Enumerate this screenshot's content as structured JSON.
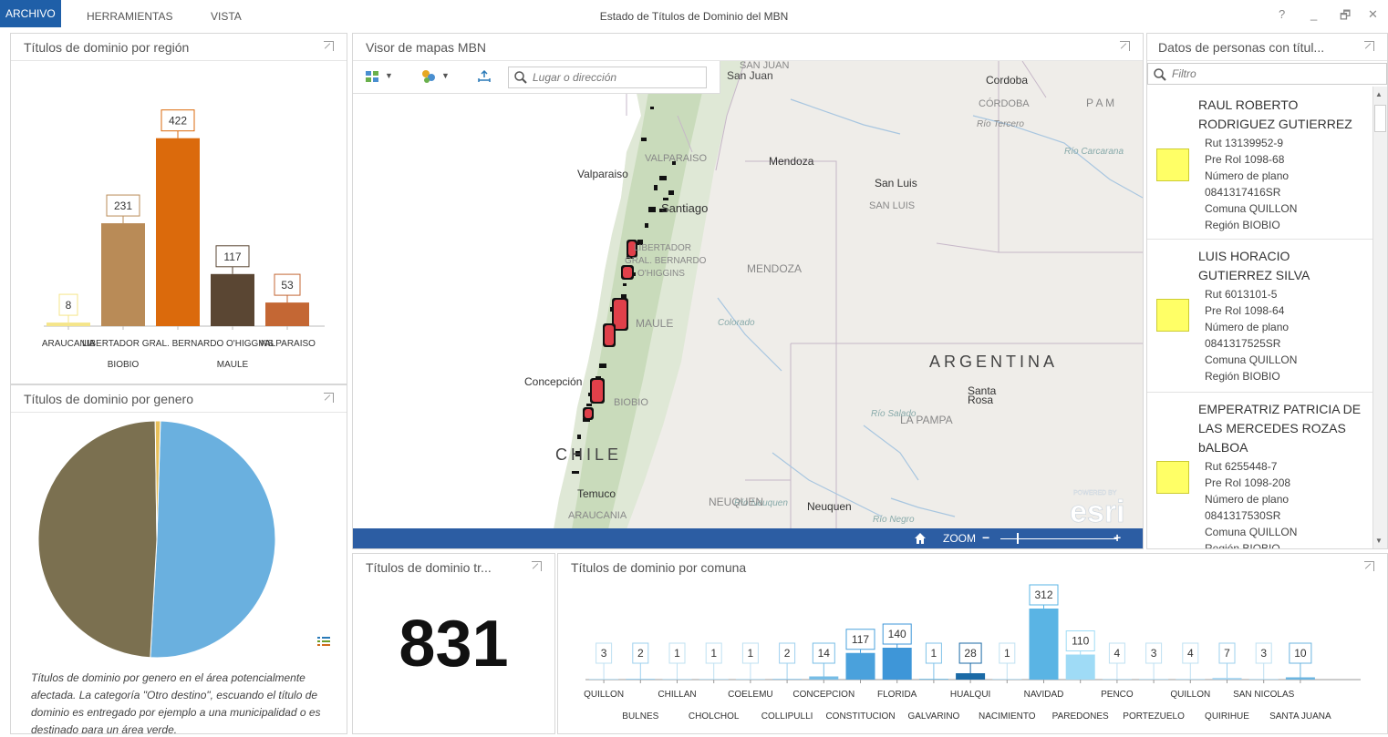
{
  "menu": {
    "archivo": "ARCHIVO",
    "herramientas": "HERRAMIENTAS",
    "vista": "VISTA"
  },
  "app_title": "Estado de Títulos de Dominio del MBN",
  "window": {
    "help": "?",
    "minimize": "_",
    "restore": "🗗",
    "close": "✕"
  },
  "panels": {
    "region_title": "Títulos de dominio por región",
    "gender_title": "Títulos de dominio por genero",
    "map_title": "Visor de mapas MBN",
    "persons_title": "Datos de personas con títul...",
    "total_title": "Títulos de dominio tr...",
    "comuna_title": "Títulos de dominio por comuna"
  },
  "region_chart": {
    "type": "bar",
    "categories": [
      "ARAUCANIA",
      "BIOBIO",
      "LIBERTADOR GRAL. BERNARDO O'HIGGINS",
      "MAULE",
      "VALPARAISO"
    ],
    "values": [
      8,
      231,
      422,
      117,
      53
    ],
    "colors": [
      "#f5e58a",
      "#b98b57",
      "#db6a0c",
      "#5a4633",
      "#c46734"
    ],
    "ylim": [
      0,
      450
    ]
  },
  "gender_chart": {
    "type": "pie",
    "values": [
      50.4,
      48.9,
      0.7
    ],
    "colors": [
      "#6ab0df",
      "#7b7050",
      "#e7bf5a"
    ],
    "legend_icon": "list-icon"
  },
  "gender_caption": "Títulos de dominio por genero en el área potencialmente afectada. La categoría \"Otro destino\", escuando el título de dominio es entregado por ejemplo a una municipalidad o es destinado para un área verde.",
  "map": {
    "search_placeholder": "Lugar o dirección",
    "labels": [
      "SAN JUAN",
      "San Juan",
      "Cordoba",
      "CÓRDOBA",
      "Río Tercero",
      "Río Carcarana",
      "Mendoza",
      "Valparaiso",
      "VALPARAISO",
      "San Luis",
      "SAN LUIS",
      "Santiago",
      "LIBERTADOR",
      "GRAL. BERNARDO",
      "O'HIGGINS",
      "MENDOZA",
      "MAULE",
      "Colorado",
      "ARGENTINA",
      "Concepción",
      "BIOBIO",
      "Santa",
      "Rosa",
      "LA PAMPA",
      "Río Salado",
      "CHILE",
      "Río Neuquen",
      "Temuco",
      "ARAUCANIA",
      "NEUQUEN",
      "Neuquen",
      "Río Negro",
      "P A M"
    ],
    "esri_small": "POWERED BY",
    "esri": "esri",
    "zoom_label": "ZOOM",
    "zoom_minus": "−",
    "zoom_plus": "+"
  },
  "filter_placeholder": "Filtro",
  "persons": [
    {
      "name": [
        "RAUL ROBERTO",
        "RODRIGUEZ GUTIERREZ"
      ],
      "details": [
        "Rut 13139952-9",
        "Pre Rol 1098-68",
        "Número de plano",
        "0841317416SR",
        "Comuna QUILLON",
        "Región BIOBIO"
      ]
    },
    {
      "name": [
        "LUIS HORACIO",
        "GUTIERREZ SILVA"
      ],
      "details": [
        "Rut 6013101-5",
        "Pre Rol 1098-64",
        "Número de plano",
        "0841317525SR",
        "Comuna QUILLON",
        "Región BIOBIO"
      ]
    },
    {
      "name": [
        "EMPERATRIZ PATRICIA DE",
        "LAS MERCEDES ROZAS",
        "bALBOA"
      ],
      "details": [
        "Rut 6255448-7",
        "Pre Rol 1098-208",
        "Número de plano",
        "0841317530SR",
        "Comuna QUILLON",
        "Región BIOBIO"
      ]
    }
  ],
  "total": "831",
  "comuna_chart": {
    "type": "bar",
    "categories": [
      "QUILLON",
      "BULNES",
      "CHILLAN",
      "CHOLCHOL",
      "COELEMU",
      "COLLIPULLI",
      "CONCEPCION",
      "CONSTITUCION",
      "FLORIDA",
      "GALVARINO",
      "HUALQUI",
      "NACIMIENTO",
      "NAVIDAD",
      "PAREDONES",
      "PENCO",
      "PORTEZUELO",
      "QUILLON",
      "QUIRIHUE",
      "SAN NICOLAS",
      "SANTA JUANA"
    ],
    "values": [
      3,
      2,
      1,
      1,
      1,
      2,
      14,
      117,
      140,
      1,
      28,
      1,
      312,
      110,
      4,
      3,
      4,
      7,
      3,
      10
    ],
    "colors": [
      "#bfe0f2",
      "#9ed0ee",
      "#bfe0f2",
      "#bfe0f2",
      "#bfe0f2",
      "#9ed0ee",
      "#77bde6",
      "#4aa1dc",
      "#3e96d8",
      "#7fc2e8",
      "#1b6aa6",
      "#bfe0f2",
      "#5ab4e4",
      "#9fdbf6",
      "#bfe0f2",
      "#bfe0f2",
      "#bfe0f2",
      "#9ed0ee",
      "#bfe0f2",
      "#6cb5e0"
    ],
    "ylim": [
      0,
      312
    ]
  }
}
